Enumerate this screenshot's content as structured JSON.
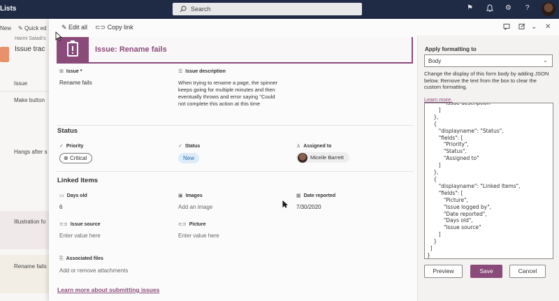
{
  "topbar": {
    "app_title": "Lists",
    "search_placeholder": "Search",
    "icons": [
      "flag-icon",
      "bell-icon",
      "gear-icon",
      "help-icon",
      "avatar"
    ]
  },
  "background_list": {
    "commands": [
      "New",
      "Quick ed"
    ],
    "owner": "Harini Saladi's",
    "list_title": "Issue trac",
    "column_header": "Issue",
    "rows": [
      "Make button",
      "Hangs after s",
      "Illustration fo",
      "Rename fails"
    ]
  },
  "panel": {
    "commands": {
      "edit_all": "Edit all",
      "copy_link": "Copy link"
    },
    "header_title": "Issue: Rename fails",
    "fields": {
      "issue": {
        "label": "Issue *",
        "value": "Rename fails"
      },
      "issue_description": {
        "label": "Issue description",
        "value": "When trying to rename a page, the spinner keeps going for multiple minutes and then eventually throws and error saying \"Could not complete this action at this time"
      }
    },
    "status_section": {
      "title": "Status",
      "priority": {
        "label": "Priority",
        "value": "Critical"
      },
      "status": {
        "label": "Status",
        "value": "New"
      },
      "assigned_to": {
        "label": "Assigned to",
        "value": "Miceile Barrett"
      }
    },
    "linked_section": {
      "title": "Linked Items",
      "days_old": {
        "label": "Days old",
        "value": "6"
      },
      "images": {
        "label": "Images",
        "value": "Add an image"
      },
      "date_reported": {
        "label": "Date reported",
        "value": "7/30/2020"
      },
      "issue_source": {
        "label": "Issue source",
        "placeholder": "Enter value here"
      },
      "picture": {
        "label": "Picture",
        "placeholder": "Enter value here"
      },
      "associated_files": {
        "label": "Associated files",
        "value": "Add or remove attachments"
      }
    },
    "learn_more_link": "Learn more about submitting issues"
  },
  "formatting": {
    "label": "Apply formatting to",
    "dropdown_value": "Body",
    "description": "Change the display of this form body by adding JSON below. Remove the text from the box to clear the custom formatting.",
    "learn_more": "Learn more.",
    "json_text": "          \"Issue description\"\n       ]\n    },\n    {\n       \"displayname\": \"Status\",\n       \"fields\": [\n          \"Priority\",\n          \"Status\",\n          \"Assigned to\"\n       ]\n    },\n    {\n       \"displayname\": \"Linked Items\",\n       \"fields\": [\n          \"Picture\",\n          \"Issue logged by\",\n          \"Date reported\",\n          \"Days old\",\n          \"Issue source\"\n       ]\n    }\n  ]\n}",
    "buttons": {
      "preview": "Preview",
      "save": "Save",
      "cancel": "Cancel"
    }
  },
  "colors": {
    "accent": "#8a4a7a",
    "suite_bar": "#1f2a44",
    "status_new_bg": "#dcecf9"
  }
}
